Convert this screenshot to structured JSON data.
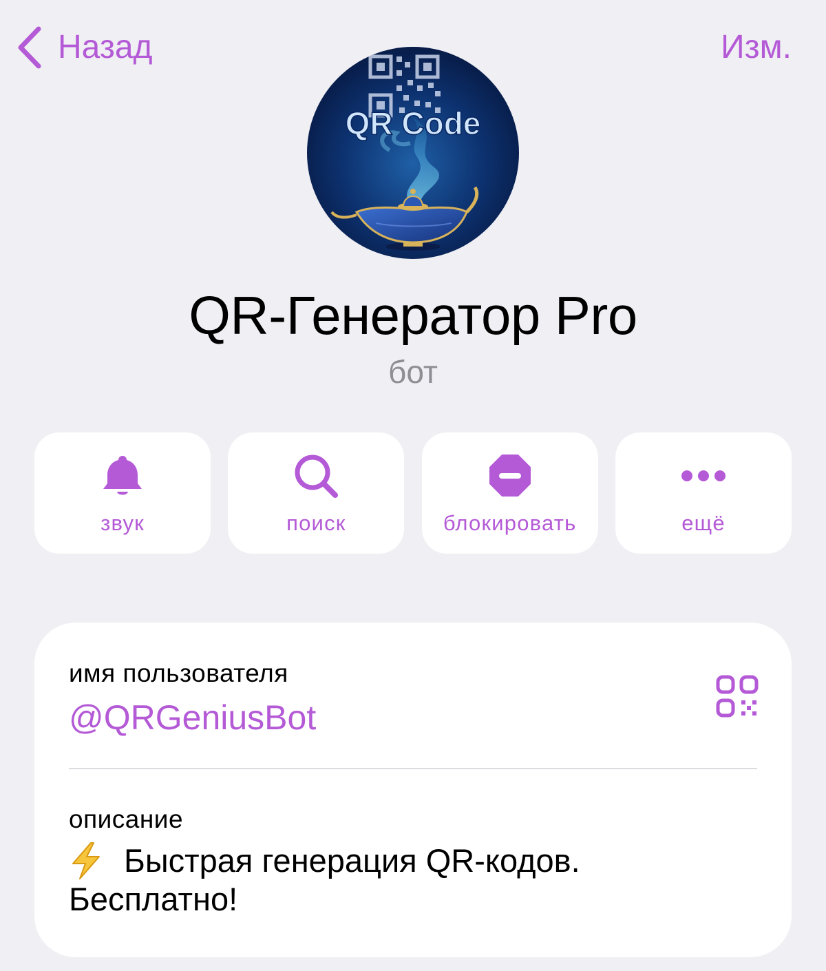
{
  "colors": {
    "accent": "#b45ad6",
    "background": "#efeff4",
    "card": "#ffffff",
    "secondary_text": "#8e8e93"
  },
  "nav": {
    "back_label": "Назад",
    "edit_label": "Изм."
  },
  "avatar": {
    "text": "QR Code"
  },
  "profile": {
    "name": "QR-Генератор Pro",
    "type": "бот"
  },
  "actions": [
    {
      "icon": "bell-icon",
      "label": "звук"
    },
    {
      "icon": "search-icon",
      "label": "поиск"
    },
    {
      "icon": "block-icon",
      "label": "блокировать"
    },
    {
      "icon": "more-icon",
      "label": "ещё"
    }
  ],
  "info": {
    "username_label": "имя пользователя",
    "username": "@QRGeniusBot",
    "qr_icon": "qr-code-icon",
    "description_label": "описание",
    "description_line1": "Быстрая генерация QR-кодов.",
    "description_line2": "Бесплатно!",
    "description_icon": "lightning-icon"
  }
}
